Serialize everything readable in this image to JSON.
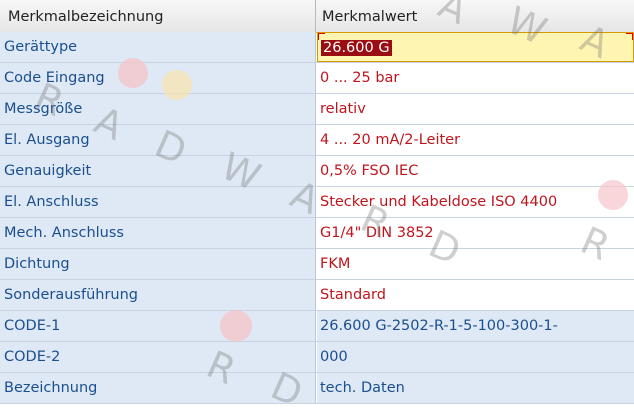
{
  "table": {
    "header": {
      "name_col": "Merkmalbezeichnung",
      "value_col": "Merkmalwert"
    },
    "rows": [
      {
        "name": "Gerättype",
        "value": "26.600 G",
        "editing": true
      },
      {
        "name": "Code Eingang",
        "value": "0 ... 25 bar"
      },
      {
        "name": "Messgröße",
        "value": "relativ"
      },
      {
        "name": "El. Ausgang",
        "value": "4 ... 20 mA/2-Leiter"
      },
      {
        "name": "Genauigkeit",
        "value": "0,5% FSO IEC"
      },
      {
        "name": "El. Anschluss",
        "value": "Stecker und Kabeldose ISO 4400"
      },
      {
        "name": "Mech. Anschluss",
        "value": "G1/4\" DIN 3852"
      },
      {
        "name": "Dichtung",
        "value": "FKM"
      },
      {
        "name": "Sonderausführung",
        "value": "Standard"
      },
      {
        "name": "CODE-1",
        "value": "26.600 G-2502-R-1-5-100-300-1-",
        "readonly": true
      },
      {
        "name": "CODE-2",
        "value": "000",
        "readonly": true
      },
      {
        "name": "Bezeichnung",
        "value": "tech. Daten",
        "readonly": true
      }
    ]
  },
  "watermark": {
    "letters": [
      "R",
      "A",
      "D",
      "W",
      "A",
      "R",
      "D",
      "R",
      "A",
      "W",
      "A",
      "R",
      "D",
      "A"
    ],
    "dot_colors": [
      "#f4c3c6",
      "#f7e3b0",
      "#f6c8cc"
    ]
  }
}
